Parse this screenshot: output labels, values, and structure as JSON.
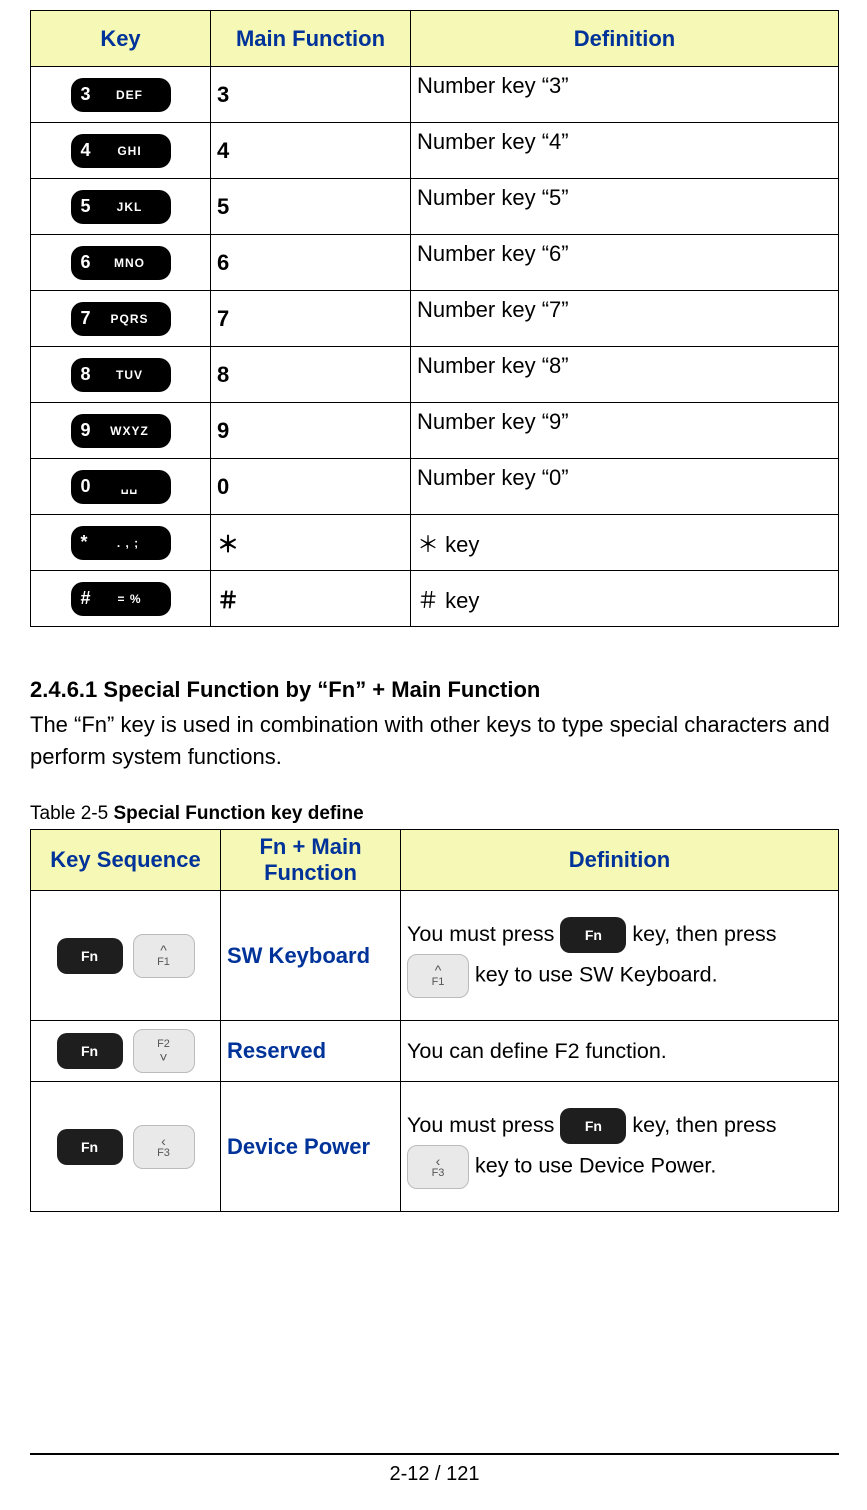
{
  "table1": {
    "headers": {
      "key": "Key",
      "fn": "Main Function",
      "def": "Definition"
    },
    "rows": [
      {
        "keycap_num": "3",
        "keycap_sub": "DEF",
        "fn": "3",
        "def": "Number key “3”"
      },
      {
        "keycap_num": "4",
        "keycap_sub": "GHI",
        "fn": "4",
        "def": "Number key “4”"
      },
      {
        "keycap_num": "5",
        "keycap_sub": "JKL",
        "fn": "5",
        "def": "Number key “5”"
      },
      {
        "keycap_num": "6",
        "keycap_sub": "MNO",
        "fn": "6",
        "def": "Number key “6”"
      },
      {
        "keycap_num": "7",
        "keycap_sub": "PQRS",
        "fn": "7",
        "def": "Number key “7”"
      },
      {
        "keycap_num": "8",
        "keycap_sub": "TUV",
        "fn": "8",
        "def": "Number key “8”"
      },
      {
        "keycap_num": "9",
        "keycap_sub": "WXYZ",
        "fn": "9",
        "def": "Number key “9”"
      },
      {
        "keycap_num": "0",
        "keycap_sub": "␣␣",
        "fn": "0",
        "def": "Number key “0”"
      },
      {
        "keycap_num": "*",
        "keycap_sub": ". , ;",
        "fn": "＊",
        "def": "＊ key"
      },
      {
        "keycap_num": "#",
        "keycap_sub": "= %",
        "fn": "＃",
        "def": "＃ key"
      }
    ]
  },
  "section": {
    "heading": "2.4.6.1 Special Function by “Fn” + Main Function",
    "body": "The “Fn” key is used in combination with other keys to type special characters and perform system functions."
  },
  "table2": {
    "caption_prefix": "Table 2-5 ",
    "caption_bold": "Special Function key define",
    "headers": {
      "key": "Key Sequence",
      "fn": "Fn + Main Function",
      "def": "Definition"
    },
    "fn_label": "Fn",
    "rows": [
      {
        "grey_top": "^",
        "grey_lab": "F1",
        "fn": "SW Keyboard",
        "def_a": "You must press ",
        "def_b": " key, then press ",
        "def_c": " key to use SW Keyboard."
      },
      {
        "grey_top": "F2",
        "grey_lab": "˅",
        "fn": "Reserved",
        "def_full": "You can define F2 function."
      },
      {
        "grey_top": "‹",
        "grey_lab": "F3",
        "fn": "Device Power",
        "def_a": "You must press ",
        "def_b": " key, then press ",
        "def_c": " key to use Device Power."
      }
    ]
  },
  "footer": "2-12 / 121"
}
